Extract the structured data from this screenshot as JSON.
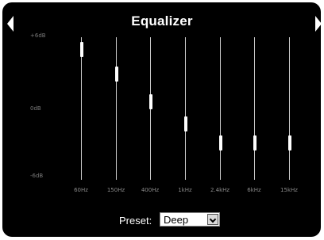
{
  "header": {
    "title": "Equalizer"
  },
  "db_scale": {
    "top": "+6dB",
    "middle": "0dB",
    "bottom": "-6dB",
    "range_db": [
      -6,
      6
    ]
  },
  "bands": [
    {
      "label": "60Hz",
      "gain_fraction": 0.915
    },
    {
      "label": "150Hz",
      "gain_fraction": 0.74
    },
    {
      "label": "400Hz",
      "gain_fraction": 0.55
    },
    {
      "label": "1kHz",
      "gain_fraction": 0.39
    },
    {
      "label": "2.4kHz",
      "gain_fraction": 0.26
    },
    {
      "label": "6kHz",
      "gain_fraction": 0.26
    },
    {
      "label": "15kHz",
      "gain_fraction": 0.26
    }
  ],
  "preset": {
    "label": "Preset:",
    "value": "Deep"
  },
  "colors": {
    "background": "#000000",
    "accent": "#ffffff"
  }
}
